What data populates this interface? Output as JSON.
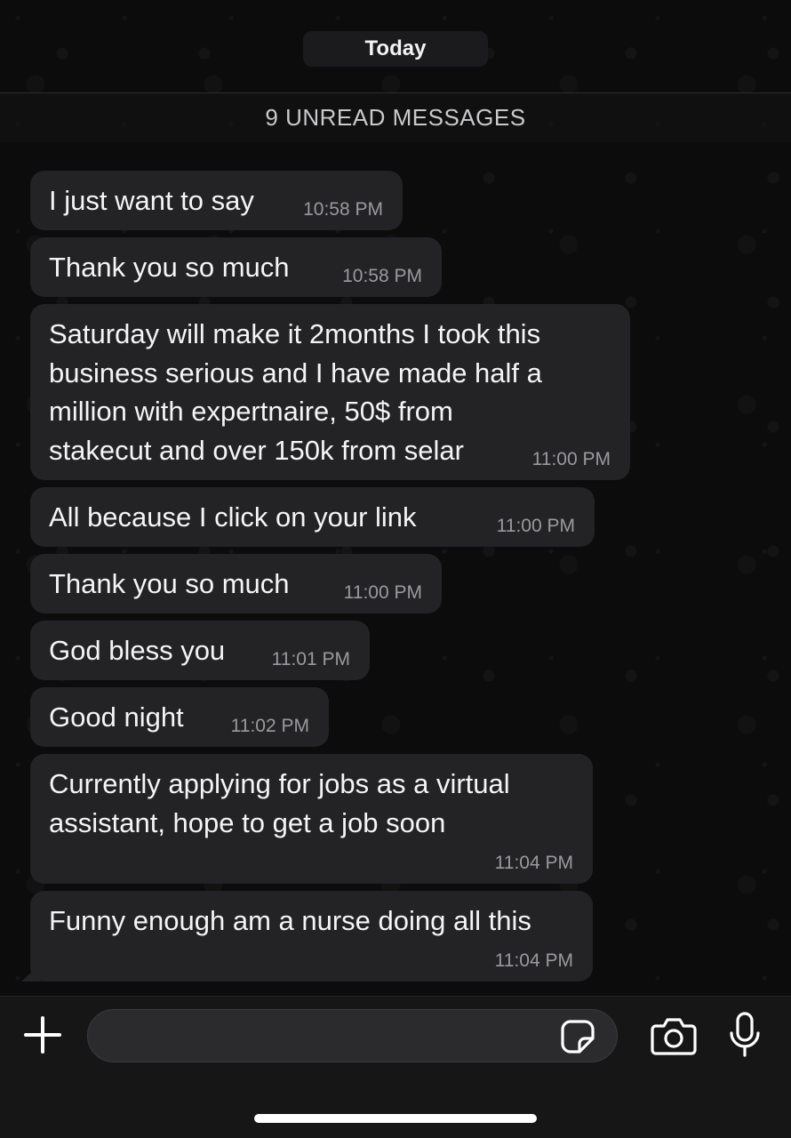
{
  "date_label": "Today",
  "unread_label": "9 UNREAD MESSAGES",
  "messages": [
    {
      "text": "I just want to say",
      "time": "10:58 PM"
    },
    {
      "text": "Thank you so much",
      "time": "10:58 PM"
    },
    {
      "text": "Saturday will make it 2months I took this\nbusiness serious and I have made half a\nmillion with expertnaire,  50$ from\nstakecut and over 150k from selar",
      "time": "11:00 PM"
    },
    {
      "text": "All because I click on your link",
      "time": "11:00 PM"
    },
    {
      "text": "Thank you so much",
      "time": "11:00 PM"
    },
    {
      "text": "God bless you",
      "time": "11:01 PM"
    },
    {
      "text": "Good night",
      "time": "11:02 PM"
    },
    {
      "text": "Currently applying for jobs as a virtual\nassistant, hope to get a job soon",
      "time": "11:04 PM"
    },
    {
      "text": "Funny enough am a nurse doing all this",
      "time": "11:04 PM"
    }
  ],
  "composer": {
    "placeholder": "",
    "icons": [
      "plus-icon",
      "sticker-icon",
      "camera-icon",
      "microphone-icon"
    ]
  },
  "colors": {
    "background": "#0c0c0d",
    "bubble": "#232325",
    "timestamp": "#9a9a9e",
    "input_bar": "#161617"
  }
}
